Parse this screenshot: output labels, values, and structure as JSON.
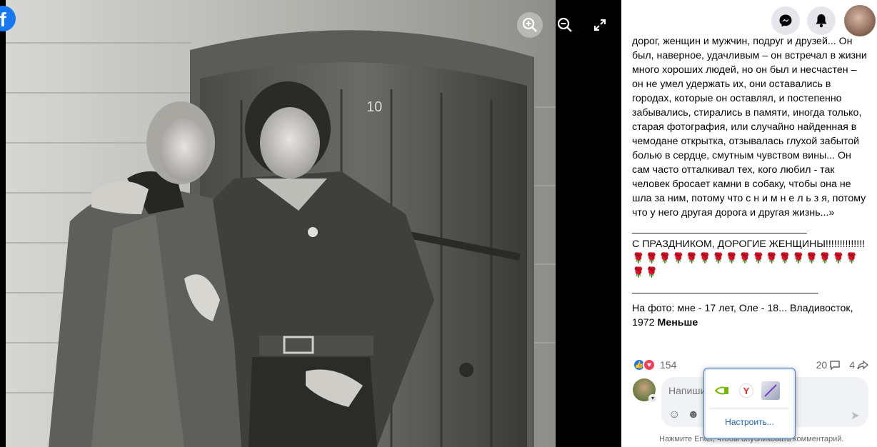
{
  "viewer": {
    "logo_letter": "f",
    "photo_alt": "Black-and-white photo: young woman and young man standing in front of a wooden door"
  },
  "post": {
    "paragraphs": [
      "дорог, женщин и мужчин, подруг и друзей... Он был, наверное, удачливым – он встречал в жизни много хороших людей, но он был и несчастен – он не умел удержать их, они оставались в городах, которые он оставлял, и постепенно забывались, стирались в памяти, иногда только, старая фотография, или случайно найденная в чемодане открытка, отзывалась глухой забытой болью в сердце, смутным чувством вины... Он сам часто отталкивал тех, кого любил - так человек бросает камни в собаку, чтобы она не шла за ним, потому что с н и м н е л ь з я, потому что у него другая дорога и другая жизнь...»",
      "_______________________________",
      "С ПРАЗДНИКОМ, ДОРОГИЕ ЖЕНЩИНЫ!!!!!!!!!!!!!!"
    ],
    "roses": "🌹🌹🌹🌹🌹🌹🌹🌹🌹🌹🌹🌹🌹🌹🌹🌹🌹🌹🌹",
    "separator2": "_________________________________",
    "caption": "На фото: мне - 17 лет, Оле - 18... Владивосток, 1972 ",
    "less_label": "Меньше"
  },
  "reactions": {
    "count": "154",
    "comments": "20",
    "shares": "4"
  },
  "comment": {
    "placeholder": "Напиши",
    "hint": "Нажмите Enter, чтобы опубликовать комментарий."
  },
  "extensions_popup": {
    "items": [
      "nvidia-extension",
      "yandex-extension",
      "pen-extension"
    ],
    "customize_label": "Настроить..."
  },
  "colors": {
    "facebook_blue": "#1877f2",
    "love_red": "#f33e58",
    "link_blue": "#1a5fb4"
  }
}
